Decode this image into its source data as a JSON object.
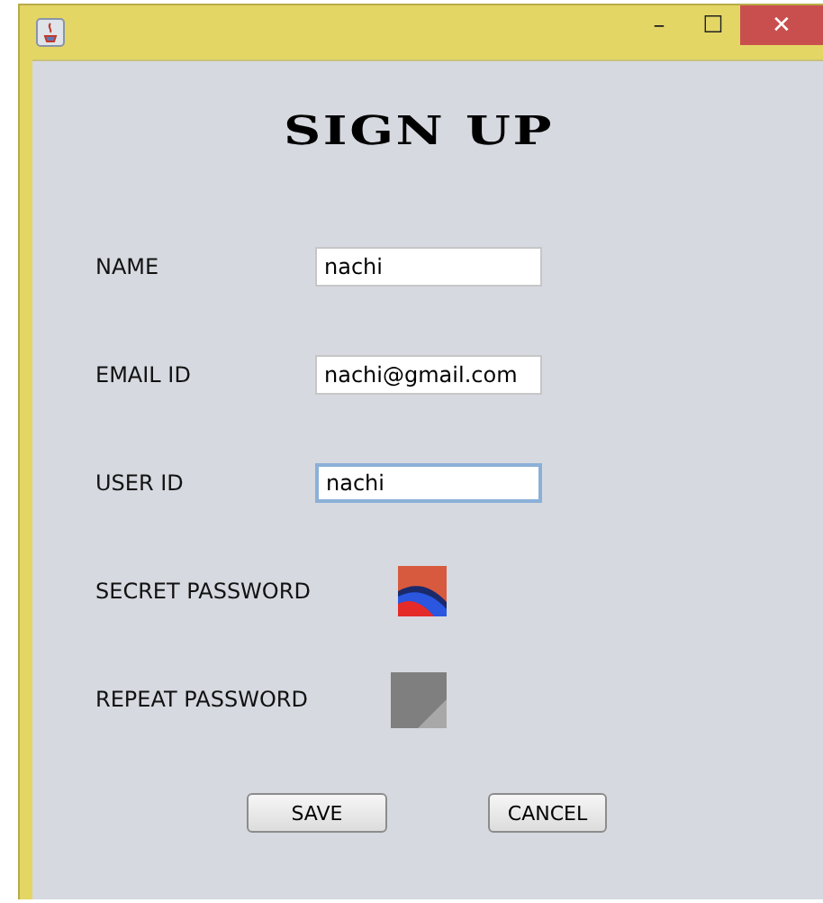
{
  "window": {
    "title_buttons": [
      "–",
      "☐",
      "✕"
    ]
  },
  "heading": "SIGN UP",
  "fields": [
    {
      "kind": "text",
      "label": "NAME",
      "value": "nachi",
      "focused": false
    },
    {
      "kind": "text",
      "label": "EMAIL ID",
      "value": "nachi@gmail.com",
      "focused": false
    },
    {
      "kind": "text",
      "label": "USER ID",
      "value": "nachi",
      "focused": true
    },
    {
      "label": "SECRET PASSWORD"
    },
    {
      "kind": "blank_image",
      "label": "REPEAT PASSWORD"
    }
  ],
  "buttons": [
    "SAVE",
    "CANCEL"
  ]
}
